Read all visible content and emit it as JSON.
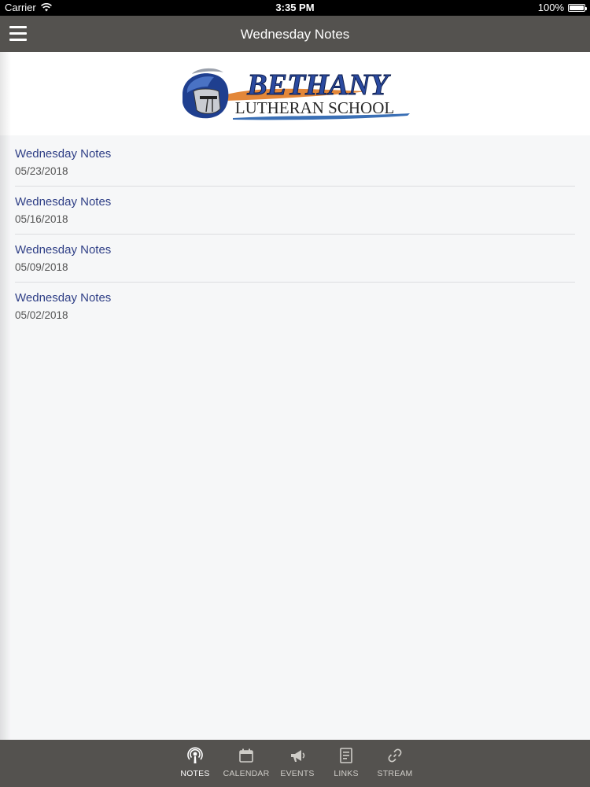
{
  "status_bar": {
    "carrier": "Carrier",
    "time": "3:35 PM",
    "battery": "100%",
    "battery_level": 1.0
  },
  "nav": {
    "title": "Wednesday Notes",
    "menu_icon": "hamburger-menu-icon"
  },
  "logo": {
    "line1": "BETHANY",
    "line2": "LUTHERAN SCHOOL"
  },
  "notes": [
    {
      "title": "Wednesday Notes",
      "date": "05/23/2018"
    },
    {
      "title": "Wednesday Notes",
      "date": "05/16/2018"
    },
    {
      "title": "Wednesday Notes",
      "date": "05/09/2018"
    },
    {
      "title": "Wednesday Notes",
      "date": "05/02/2018"
    }
  ],
  "tabs": [
    {
      "label": "NOTES",
      "icon": "podcast-icon",
      "active": true
    },
    {
      "label": "CALENDAR",
      "icon": "calendar-icon",
      "active": false
    },
    {
      "label": "EVENTS",
      "icon": "megaphone-icon",
      "active": false
    },
    {
      "label": "LINKS",
      "icon": "document-icon",
      "active": false
    },
    {
      "label": "STREAM",
      "icon": "link-icon",
      "active": false
    }
  ],
  "colors": {
    "bar_background": "#54524f",
    "note_title": "#2f3f86",
    "logo_blue": "#2b4aa0",
    "logo_orange": "#e07a24"
  }
}
